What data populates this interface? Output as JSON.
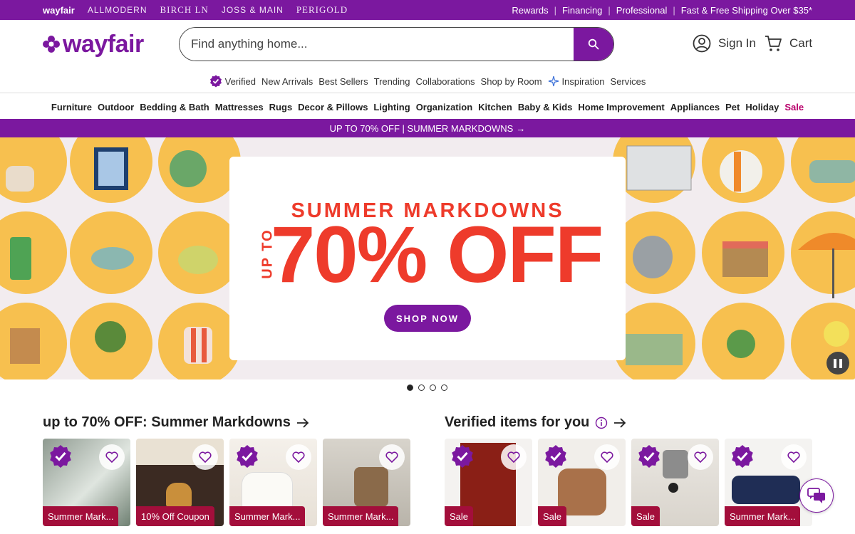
{
  "topbar": {
    "brands": [
      "wayfair",
      "ALLMODERN",
      "BIRCH LN",
      "JOSS & MAIN",
      "PERIGOLD"
    ],
    "links": [
      "Rewards",
      "Financing",
      "Professional",
      "Fast & Free Shipping Over $35*"
    ]
  },
  "header": {
    "logo_text": "wayfair",
    "search_placeholder": "Find anything home...",
    "sign_in_label": "Sign In",
    "cart_label": "Cart"
  },
  "subnav": [
    "Verified",
    "New Arrivals",
    "Best Sellers",
    "Trending",
    "Collaborations",
    "Shop by Room",
    "Inspiration",
    "Services"
  ],
  "categories": [
    "Furniture",
    "Outdoor",
    "Bedding & Bath",
    "Mattresses",
    "Rugs",
    "Decor & Pillows",
    "Lighting",
    "Organization",
    "Kitchen",
    "Baby & Kids",
    "Home Improvement",
    "Appliances",
    "Pet",
    "Holiday",
    "Sale"
  ],
  "promo_bar": {
    "text": "UP TO 70% OFF | SUMMER MARKDOWNS",
    "arrow": "→"
  },
  "hero": {
    "subtitle": "SUMMER MARKDOWNS",
    "upto": "UP TO",
    "headline": "70% OFF",
    "cta": "SHOP NOW",
    "slide_count": 4,
    "active_slide": 1
  },
  "sections": {
    "markdowns": {
      "title": "up to 70% OFF: Summer Markdowns",
      "tiles": [
        {
          "label": "Summer Mark...",
          "verified": true
        },
        {
          "label": "10% Off Coupon",
          "verified": false
        },
        {
          "label": "Summer Mark...",
          "verified": true
        },
        {
          "label": "Summer Mark...",
          "verified": false
        }
      ]
    },
    "verified": {
      "title": "Verified items for you",
      "tiles": [
        {
          "label": "Sale",
          "verified": true
        },
        {
          "label": "Sale",
          "verified": true
        },
        {
          "label": "Sale",
          "verified": true
        },
        {
          "label": "Summer Mark...",
          "verified": true
        }
      ]
    }
  },
  "colors": {
    "brand_purple": "#7b189f",
    "hero_red": "#ee3b2b",
    "sale_pink": "#b8006b",
    "label_red": "#a30e3b",
    "dot_yellow": "#f7c04f"
  },
  "icons": [
    "search-icon",
    "user-icon",
    "cart-icon",
    "verified-icon",
    "sparkle-icon",
    "heart-icon",
    "arrow-right-icon",
    "info-icon",
    "pause-icon",
    "chat-icon"
  ]
}
